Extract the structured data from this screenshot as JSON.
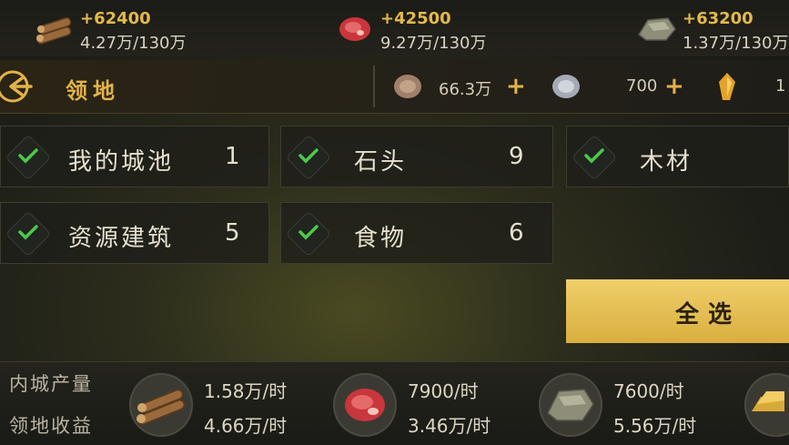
{
  "resources": [
    {
      "icon": "wood-icon",
      "gain": "+62400",
      "amount": "4.27万/130万"
    },
    {
      "icon": "meat-icon",
      "gain": "+42500",
      "amount": "9.27万/130万"
    },
    {
      "icon": "stone-icon",
      "gain": "+63200",
      "amount": "1.37万/130万"
    }
  ],
  "header": {
    "title": "领地",
    "currencies": [
      {
        "icon": "copper-coin-icon",
        "value": "66.3万"
      },
      {
        "icon": "silver-coin-icon",
        "value": "700"
      },
      {
        "icon": "gold-crystal-icon",
        "value": "1"
      }
    ]
  },
  "filters": [
    {
      "label": "我的城池",
      "count": "1"
    },
    {
      "label": "石头",
      "count": "9"
    },
    {
      "label": "木材",
      "count": ""
    },
    {
      "label": "资源建筑",
      "count": "5"
    },
    {
      "label": "食物",
      "count": "6"
    }
  ],
  "select_all_label": "全选",
  "production": {
    "inner_label": "内城产量",
    "territory_label": "领地收益",
    "items": [
      {
        "icon": "wood-icon",
        "inner": "1.58万/时",
        "territory": "4.66万/时"
      },
      {
        "icon": "meat-icon",
        "inner": "7900/时",
        "territory": "3.46万/时"
      },
      {
        "icon": "stone-icon",
        "inner": "7600/时",
        "territory": "5.56万/时"
      },
      {
        "icon": "gold-ingot-icon",
        "inner": "",
        "territory": ""
      }
    ]
  },
  "colors": {
    "accent": "#e2b24a",
    "check": "#4cc94a",
    "select_all": "#e6c05a"
  }
}
